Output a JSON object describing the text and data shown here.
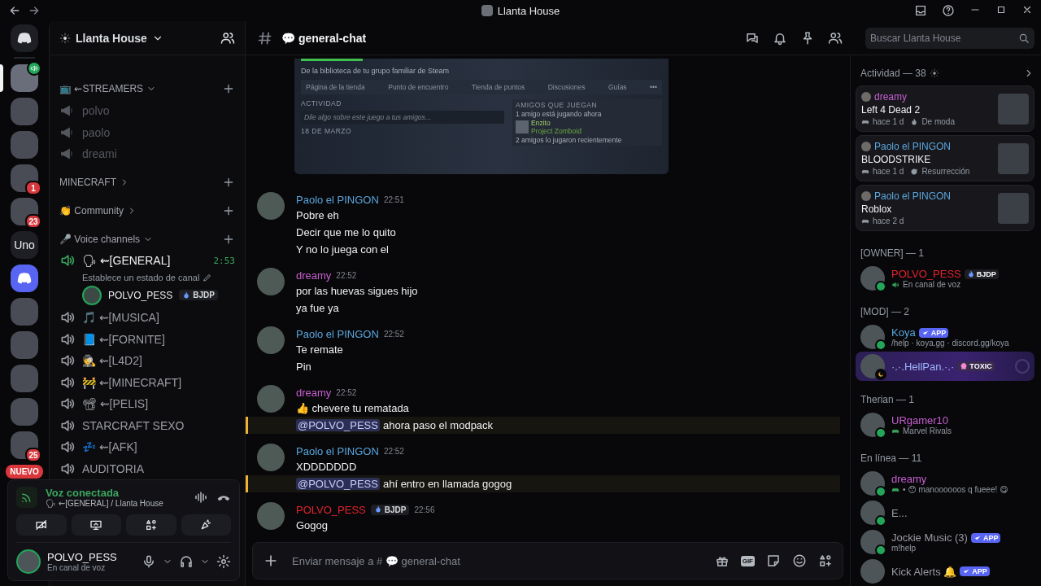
{
  "title_bar": {
    "title": "Llanta House"
  },
  "servers": [
    {
      "kind": "home",
      "selected": false,
      "voice": false
    },
    {
      "kind": "image",
      "selected": true,
      "voice": true
    },
    {
      "kind": "image",
      "selected": false,
      "voice": false
    },
    {
      "kind": "image",
      "selected": false,
      "voice": false
    },
    {
      "kind": "image",
      "selected": false,
      "voice": false,
      "badge": "1"
    },
    {
      "kind": "image",
      "selected": false,
      "voice": false,
      "badge": "23"
    },
    {
      "kind": "text",
      "selected": false,
      "voice": false,
      "label": "Uno"
    },
    {
      "kind": "app",
      "selected": false,
      "voice": false
    },
    {
      "kind": "image",
      "selected": false,
      "voice": false
    },
    {
      "kind": "image",
      "selected": false,
      "voice": false
    },
    {
      "kind": "image",
      "selected": false,
      "voice": false
    },
    {
      "kind": "image",
      "selected": false,
      "voice": false
    },
    {
      "kind": "image",
      "selected": false,
      "voice": false,
      "badge": "25"
    }
  ],
  "new_badge": "NUEVO",
  "sidebar": {
    "server_name": "Llanta House",
    "items": [
      {
        "kind": "category",
        "label": "📺 ⇜STREAMERS",
        "expanded": true
      },
      {
        "kind": "stage",
        "label": "polvo"
      },
      {
        "kind": "stage",
        "label": "paolo"
      },
      {
        "kind": "stage",
        "label": "dreami"
      },
      {
        "kind": "category",
        "label": "MINECRAFT",
        "expanded": false
      },
      {
        "kind": "category",
        "label": "👏 Community",
        "expanded": false
      },
      {
        "kind": "category",
        "label": "🎤 Voice channels",
        "expanded": true
      },
      {
        "kind": "voice",
        "label": "🗣 ⇜[GENERAL]",
        "connected": true,
        "time": "2:53",
        "status": "Establece un estado de canal",
        "users": [
          {
            "name": "POLVO_PESS",
            "tag": "BJDP"
          }
        ]
      },
      {
        "kind": "voice",
        "label": "🎵 ⇜[MUSICA]",
        "connected": false
      },
      {
        "kind": "voice",
        "label": "📘 ⇜[FORNITE]",
        "connected": false
      },
      {
        "kind": "voice",
        "label": "🕵 ⇜[L4D2]",
        "connected": false
      },
      {
        "kind": "voice",
        "label": "🚧 ⇜[MINECRAFT]",
        "connected": false
      },
      {
        "kind": "voice",
        "label": "📽 ⇜[PELIS]",
        "connected": false
      },
      {
        "kind": "voice",
        "label": "STARCRAFT SEXO",
        "connected": false
      },
      {
        "kind": "voice",
        "label": "💤 ⇜[AFK]",
        "connected": false
      },
      {
        "kind": "voice",
        "label": "AUDITORIA",
        "connected": false
      }
    ]
  },
  "voice_panel": {
    "title": "Voz conectada",
    "channel": "🗣 ⇜[GENERAL] / Llanta House"
  },
  "user_panel": {
    "name": "POLVO_PESS",
    "status": "En canal de voz"
  },
  "chat_header": {
    "channel": "💬 general-chat",
    "search_placeholder": "Buscar Llanta House"
  },
  "embed": {
    "subtitle": "De la biblioteca de tu grupo familiar de Steam",
    "tabs": [
      "Página de la tienda",
      "Punto de encuentro",
      "Tienda de puntos",
      "Discusiones",
      "Guías",
      "•••"
    ],
    "activity_heading": "ACTIVIDAD",
    "activity_placeholder": "Dile algo sobre este juego a tus amigos...",
    "date": "18 DE MARZO",
    "friends_heading": "AMIGOS QUE JUEGAN",
    "playing_now": "1 amigo está jugando ahora",
    "friend_name": "Enzito",
    "friend_game": "Project Zomboid",
    "recent": "2 amigos lo jugaron recientemente"
  },
  "messages": [
    {
      "author": "Paolo el PINGON",
      "color": "#5aa5dc",
      "time": "22:51",
      "lines": [
        {
          "text": "Pobre eh"
        },
        {
          "text": "Decir que me lo quito"
        },
        {
          "text": "Y no lo juega con el"
        }
      ]
    },
    {
      "author": "dreamy",
      "color": "#c65fd0",
      "time": "22:52",
      "lines": [
        {
          "text": "por las huevas sigues hijo"
        },
        {
          "text": "ya fue ya"
        }
      ]
    },
    {
      "author": "Paolo el PINGON",
      "color": "#5aa5dc",
      "time": "22:52",
      "lines": [
        {
          "text": "Te remate"
        },
        {
          "text": "Pin"
        }
      ]
    },
    {
      "author": "dreamy",
      "color": "#c65fd0",
      "time": "22:52",
      "lines": [
        {
          "text": "👍 chevere tu rematada"
        },
        {
          "mention": "@POLVO_PESS",
          "text": "ahora paso el modpack"
        }
      ]
    },
    {
      "author": "Paolo el PINGON",
      "color": "#5aa5dc",
      "time": "22:52",
      "lines": [
        {
          "text": "XDDDDDDD"
        },
        {
          "mention": "@POLVO_PESS",
          "text": "ahí entro en llamada gogog"
        }
      ]
    },
    {
      "author": "POLVO_PESS",
      "color": "#e3232c",
      "tag": "BJDP",
      "time": "22:56",
      "lines": [
        {
          "text": "Gogog"
        }
      ]
    }
  ],
  "composer": {
    "placeholder": "Enviar mensaje a # 💬 general-chat",
    "gif_label": "GIF"
  },
  "activity": {
    "title": "Actividad — 38",
    "cards": [
      {
        "user": "dreamy",
        "color": "#c65fd0",
        "game": "Left 4 Dead 2",
        "meta": [
          {
            "kind": "time",
            "text": "hace 1 d"
          },
          {
            "kind": "trending",
            "text": "De moda"
          }
        ]
      },
      {
        "user": "Paolo el PINGON",
        "color": "#5aa5dc",
        "game": "BLOODSTRIKE",
        "meta": [
          {
            "kind": "time",
            "text": "hace 1 d"
          },
          {
            "kind": "revival",
            "text": "Resurrección"
          }
        ]
      },
      {
        "user": "Paolo el PINGON",
        "color": "#5aa5dc",
        "game": "Roblox",
        "meta": [
          {
            "kind": "time",
            "text": "hace 2 d"
          }
        ]
      }
    ]
  },
  "member_groups": [
    {
      "title": "[OWNER] — 1",
      "members": [
        {
          "name": "POLVO_PESS",
          "color": "#e3232c",
          "idle": false,
          "nameplate": false,
          "badge": {
            "kind": "guild",
            "text": "BJDP"
          },
          "sub": {
            "kind": "voice",
            "text": "En canal de voz"
          }
        }
      ]
    },
    {
      "title": "[MOD] — 2",
      "members": [
        {
          "name": "Koya",
          "color": "#5aa5dc",
          "idle": false,
          "nameplate": false,
          "badge": {
            "kind": "app",
            "text": "APP"
          },
          "sub": {
            "kind": "text",
            "text": "/help · koya.gg · discord.gg/koya"
          }
        },
        {
          "name": "·.·.HellPan.·.·",
          "color": "#9fb4ff",
          "idle": true,
          "nameplate": true,
          "badge": {
            "kind": "skull",
            "text": "TOXIC"
          }
        }
      ]
    },
    {
      "title": "Therian — 1",
      "members": [
        {
          "name": "URgamer10",
          "color": "#c65fd0",
          "idle": false,
          "nameplate": false,
          "sub": {
            "kind": "game",
            "text": "Marvel Rivals"
          }
        }
      ]
    },
    {
      "title": "En línea — 11",
      "members": [
        {
          "name": "dreamy",
          "color": "#c65fd0",
          "idle": false,
          "nameplate": false,
          "sub": {
            "kind": "game",
            "text": "• 😯 manoooooos q fueee! 😋"
          }
        },
        {
          "name": "E...",
          "color": "#9a9ba3",
          "idle": false,
          "nameplate": false
        },
        {
          "name": "Jockie Music (3)",
          "color": "#9a9ba3",
          "idle": false,
          "nameplate": false,
          "badge": {
            "kind": "app",
            "text": "APP"
          },
          "sub": {
            "kind": "text",
            "text": "m!help"
          }
        },
        {
          "name": "Kick Alerts 🔔",
          "color": "#9a9ba3",
          "nameplate": false,
          "badge": {
            "kind": "app",
            "text": "APP"
          }
        }
      ]
    }
  ]
}
